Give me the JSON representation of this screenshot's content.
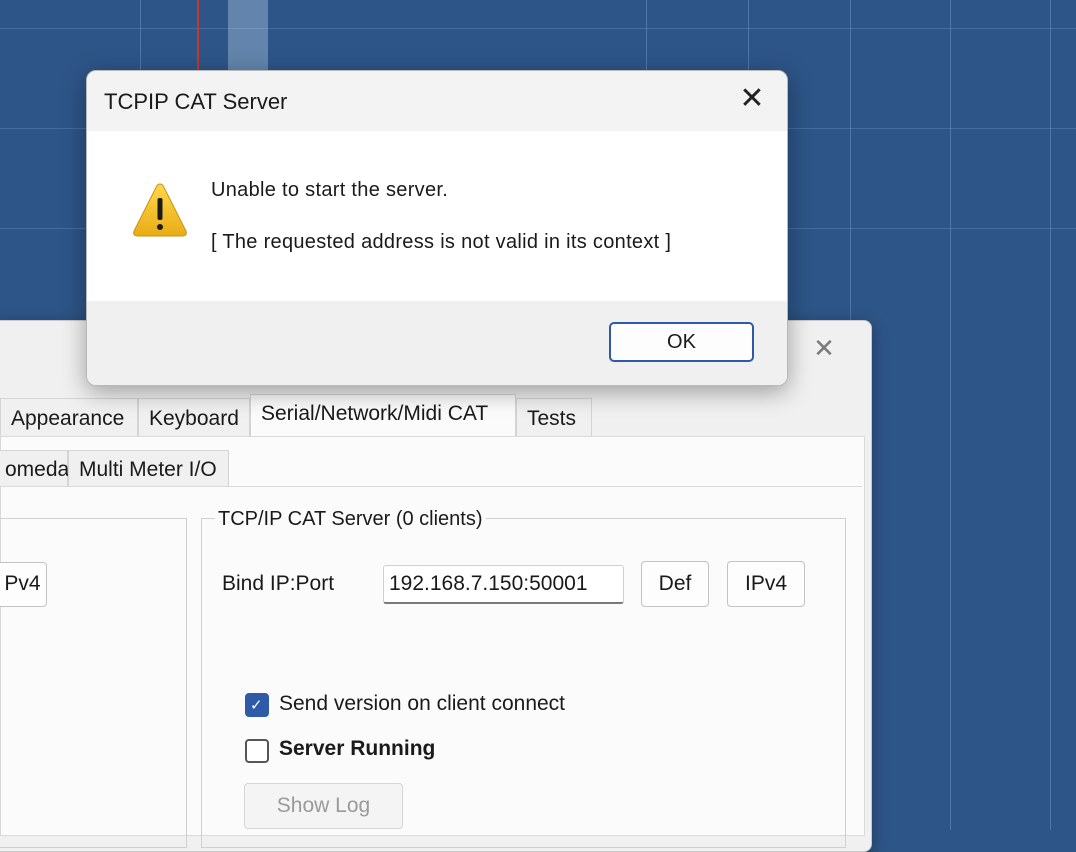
{
  "dialog": {
    "title": "TCPIP CAT Server",
    "close_icon": "close-icon",
    "icon": "warning-icon",
    "message_line1": "Unable to start the server.",
    "message_line2": "[ The requested address is not valid in its context ]",
    "ok_label": "OK"
  },
  "settings": {
    "close_icon": "close-icon",
    "tabs": [
      {
        "label": "Appearance",
        "active": false
      },
      {
        "label": "Keyboard",
        "active": false
      },
      {
        "label": "Serial/Network/Midi CAT",
        "active": true
      },
      {
        "label": "Tests",
        "active": false
      }
    ],
    "subtabs": [
      {
        "label": "omeda"
      },
      {
        "label": "Multi Meter I/O"
      }
    ],
    "left_group": {
      "ipv4_label": "Pv4"
    },
    "tcp_group": {
      "title": "TCP/IP CAT Server (0 clients)",
      "bind_label": "Bind IP:Port",
      "bind_value": "192.168.7.150:50001",
      "def_label": "Def",
      "ipv4_label": "IPv4",
      "send_version_label": "Send version on client connect",
      "send_version_checked": true,
      "server_running_label": "Server Running",
      "server_running_checked": false,
      "show_log_label": "Show Log"
    }
  },
  "colors": {
    "desktop": "#2d5587",
    "accent": "#2f5aa8",
    "warning": "#f2c230"
  }
}
